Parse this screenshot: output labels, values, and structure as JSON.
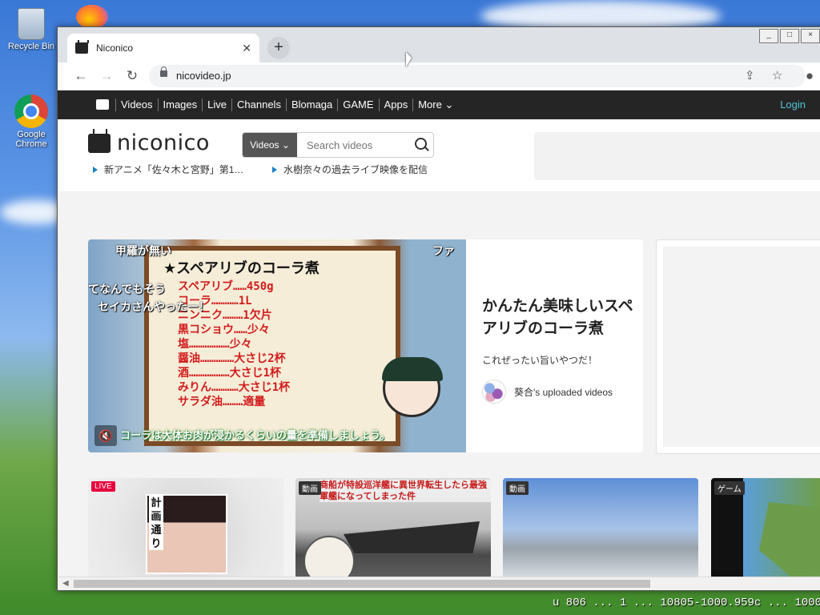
{
  "desktop": {
    "icons": [
      {
        "label": "Recycle Bin"
      },
      {
        "label": "Google Chrome"
      }
    ],
    "taskbar_fragment": "u 806 ... 1 ... 10805-1000.959c ... 1000"
  },
  "browser": {
    "tab_title": "Niconico",
    "new_tab_symbol": "+",
    "url": "nicovideo.jp",
    "window_controls": [
      "_",
      "□",
      "×"
    ]
  },
  "nav": {
    "links": [
      "Videos",
      "Images",
      "Live",
      "Channels",
      "Blomaga",
      "GAME",
      "Apps",
      "More"
    ],
    "login": "Login"
  },
  "header": {
    "logo_text": "niconico",
    "search_category": "Videos ⌄",
    "search_placeholder": "Search videos",
    "news": [
      "新アニメ「佐々木と宮野」第1…",
      "水樹奈々の過去ライブ映像を配信"
    ]
  },
  "feature": {
    "overlay_top_left": "甲羅が無い",
    "overlay_top_right": "ファ",
    "overlay_left_1": "てなんでもそう",
    "overlay_left_2": "セイカさんやったー！",
    "board_title": "★スペアリブのコーラ煮",
    "recipe_lines": [
      "スペアリブ……450g",
      "コーラ…………1L",
      "ニンニク………1欠片",
      "黒コショウ……少々",
      "塩………………少々",
      "醤油……………大さじ2杯",
      "酒………………大さじ1杯",
      "みりん…………大さじ1杯",
      "サラダ油………適量"
    ],
    "subtitle": "コーラは大体お肉が浸かるくらいの量を準備しましょう。",
    "title": "かんたん美味しいスペアリブのコーラ煮",
    "description": "これぜったい旨いやつだ！",
    "uploader": "葵合's uploaded videos"
  },
  "cards": [
    {
      "badge": "LIVE",
      "badge_color": "#e5003c",
      "image_text": "計画通り"
    },
    {
      "badge": "動画",
      "badge_color": "#333333",
      "image_text": "商船が特設巡洋艦に異世界転生したら最強軍艦になってしまった件"
    },
    {
      "badge": "動画",
      "badge_color": "#333333",
      "image_text": ""
    },
    {
      "badge": "ゲーム",
      "badge_color": "#333333",
      "image_text": ""
    }
  ]
}
